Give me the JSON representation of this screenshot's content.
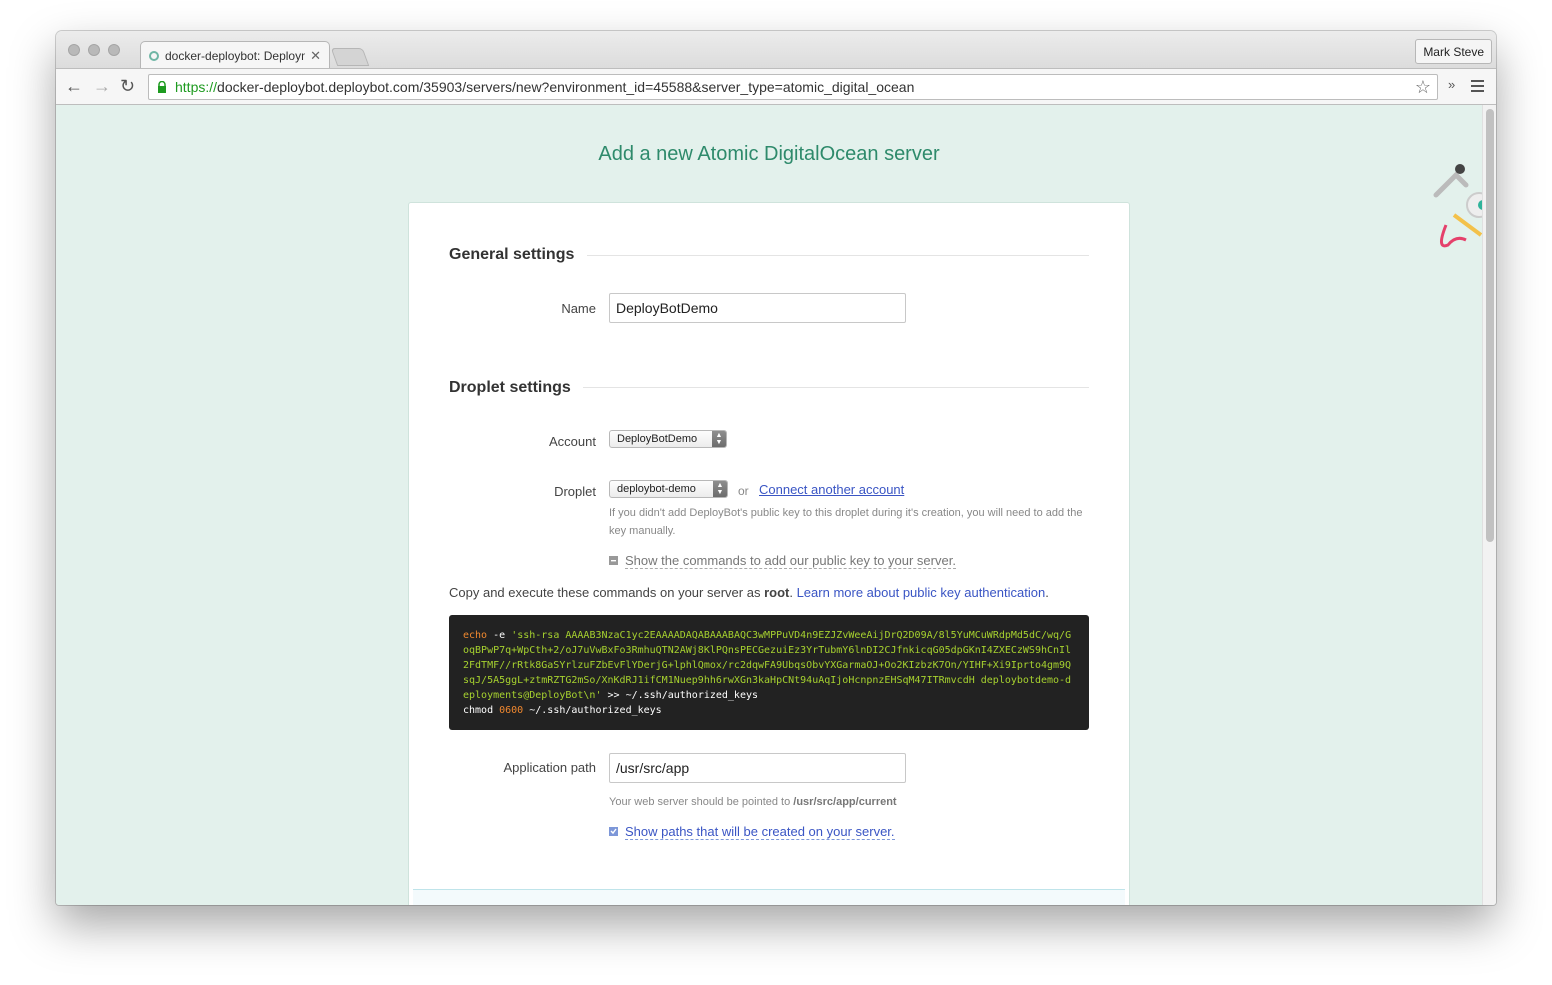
{
  "browser": {
    "tab_title": "docker-deploybot: Deployments",
    "profile_name": "Mark Steve",
    "url_scheme": "https://",
    "url_rest": "docker-deploybot.deploybot.com/35903/servers/new?environment_id=45588&server_type=atomic_digital_ocean",
    "extensions_label": "»"
  },
  "page": {
    "title": "Add a new Atomic DigitalOcean server"
  },
  "general": {
    "heading": "General settings",
    "name_label": "Name",
    "name_value": "DeployBotDemo"
  },
  "droplet": {
    "heading": "Droplet settings",
    "account_label": "Account",
    "account_value": "DeployBotDemo",
    "droplet_label": "Droplet",
    "droplet_value": "deploybot-demo",
    "or_text": "or",
    "connect_link": "Connect another account",
    "help_text": "If you didn't add DeployBot's public key to this droplet during it's creation, you will need to add the key manually.",
    "show_commands_toggle": "Show the commands to add our public key to your server.",
    "copy_prefix": "Copy and execute these commands on your server as ",
    "copy_bold": "root",
    "copy_separator": ". ",
    "learn_more_link": "Learn more about public key authentication",
    "copy_suffix": "."
  },
  "code": {
    "cmd1": "echo",
    "flag": " -e ",
    "key_string": "'ssh-rsa AAAAB3NzaC1yc2EAAAADAQABAAABAQC3wMPPuVD4n9EZJZvWeeAijDrQ2D09A/8l5YuMCuWRdpMd5dC/wq/GoqBPwP7q+WpCth+2/oJ7uVwBxFo3RmhuQTN2AWj8KlPQnsPECGezuiEz3YrTubmY6lnDI2CJfnkicqG05dpGKnI4ZXECzWS9hCnIl2FdTMF//rRtk8GaSYrlzuFZbEvFlYDerjG+lphlQmox/rc2dqwFA9UbqsObvYXGarmaOJ+Oo2KIzbzK7On/YIHF+Xi9Iprto4gm9QsqJ/5A5ggL+ztmRZTG2mSo/XnKdRJ1ifCM1Nuep9hh6rwXGn3kaHpCNt94uAqIjoHcnpnzEHSqM47ITRmvcdH deploybotdemo-deployments@DeployBot\\n'",
    "redirect": " >> ~/.ssh/authorized_keys",
    "cmd2": "chmod ",
    "mode": "0600",
    "path": " ~/.ssh/authorized_keys"
  },
  "app_path": {
    "label": "Application path",
    "value": "/usr/src/app",
    "hint_prefix": "Your web server should be pointed to ",
    "hint_path": "/usr/src/app/current",
    "show_paths_toggle": "Show paths that will be created on your server."
  },
  "colors": {
    "page_bg": "#e3f1ec",
    "title_green": "#2e8a6b",
    "link_blue": "#3a55c4",
    "code_bg": "#222222",
    "code_string": "#a6d12f",
    "code_keyword": "#f0882f"
  }
}
